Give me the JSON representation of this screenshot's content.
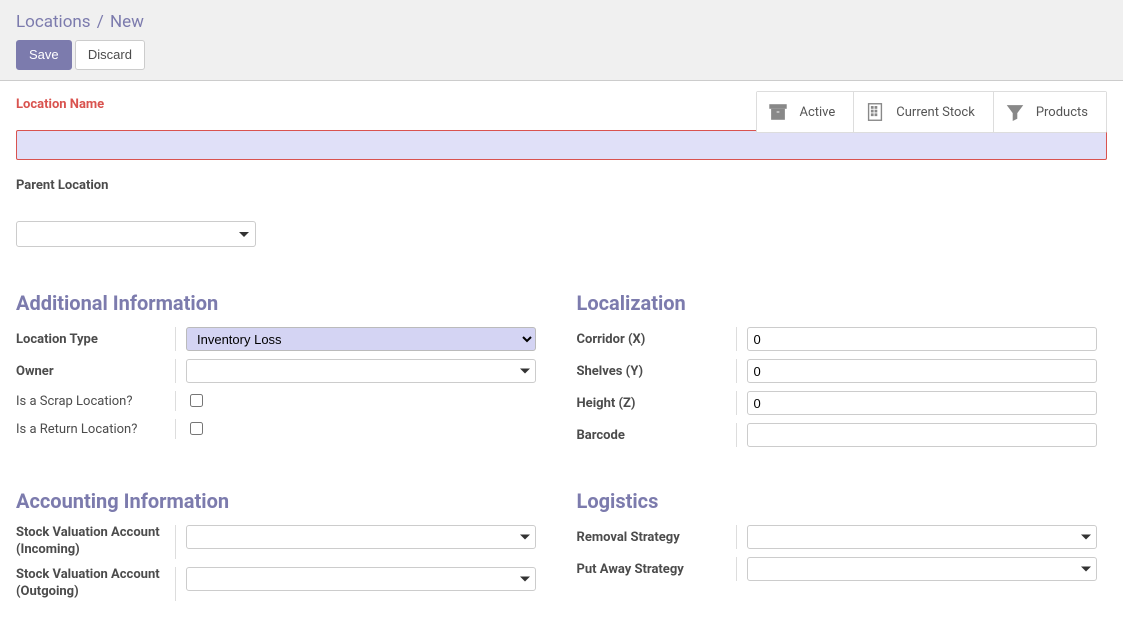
{
  "breadcrumb": {
    "root": "Locations",
    "sep": "/",
    "current": "New"
  },
  "buttons": {
    "save": "Save",
    "discard": "Discard"
  },
  "statbuttons": {
    "active": "Active",
    "current_stock": "Current Stock",
    "products": "Products"
  },
  "location_name_label": "Location Name",
  "location_name_value": "",
  "parent_location_label": "Parent Location",
  "parent_location_value": "",
  "sections": {
    "additional": "Additional Information",
    "localization": "Localization",
    "accounting": "Accounting Information",
    "logistics": "Logistics"
  },
  "additional": {
    "location_type_label": "Location Type",
    "location_type_value": "Inventory Loss",
    "owner_label": "Owner",
    "owner_value": "",
    "scrap_label": "Is a Scrap Location?",
    "scrap_checked": false,
    "return_label": "Is a Return Location?",
    "return_checked": false
  },
  "localization": {
    "corridor_label": "Corridor (X)",
    "corridor_value": "0",
    "shelves_label": "Shelves (Y)",
    "shelves_value": "0",
    "height_label": "Height (Z)",
    "height_value": "0",
    "barcode_label": "Barcode",
    "barcode_value": ""
  },
  "accounting": {
    "incoming_label": "Stock Valuation Account (Incoming)",
    "incoming_value": "",
    "outgoing_label": "Stock Valuation Account (Outgoing)",
    "outgoing_value": ""
  },
  "logistics": {
    "removal_label": "Removal Strategy",
    "removal_value": "",
    "putaway_label": "Put Away Strategy",
    "putaway_value": ""
  }
}
